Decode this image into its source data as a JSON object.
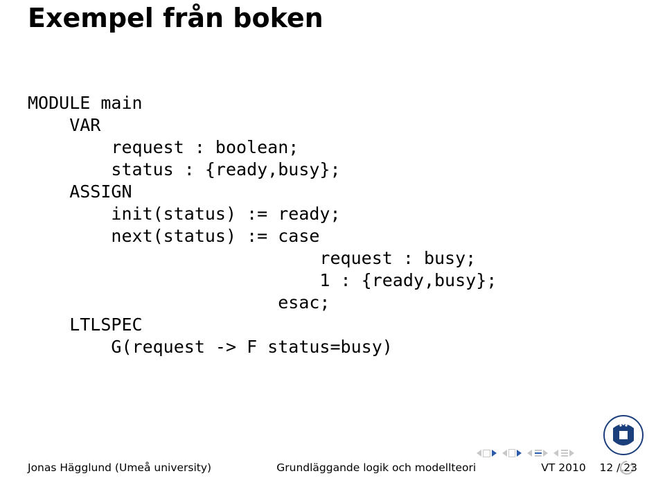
{
  "title": "Exempel från boken",
  "code": {
    "l1": "MODULE main",
    "l2": "    VAR",
    "l3": "        request : boolean;",
    "l4": "        status : {ready,busy};",
    "l5": "    ASSIGN",
    "l6": "        init(status) := ready;",
    "l7": "        next(status) := case",
    "l8": "                            request : busy;",
    "l9": "                            1 : {ready,busy};",
    "l10": "                        esac;",
    "l11": "    LTLSPEC",
    "l12": "        G(request -> F status=busy)"
  },
  "footer": {
    "author": "Jonas Hägglund (Umeå university)",
    "course": "Grundläggande logik och modellteori",
    "term": "VT 2010",
    "page": "12 / 23"
  }
}
